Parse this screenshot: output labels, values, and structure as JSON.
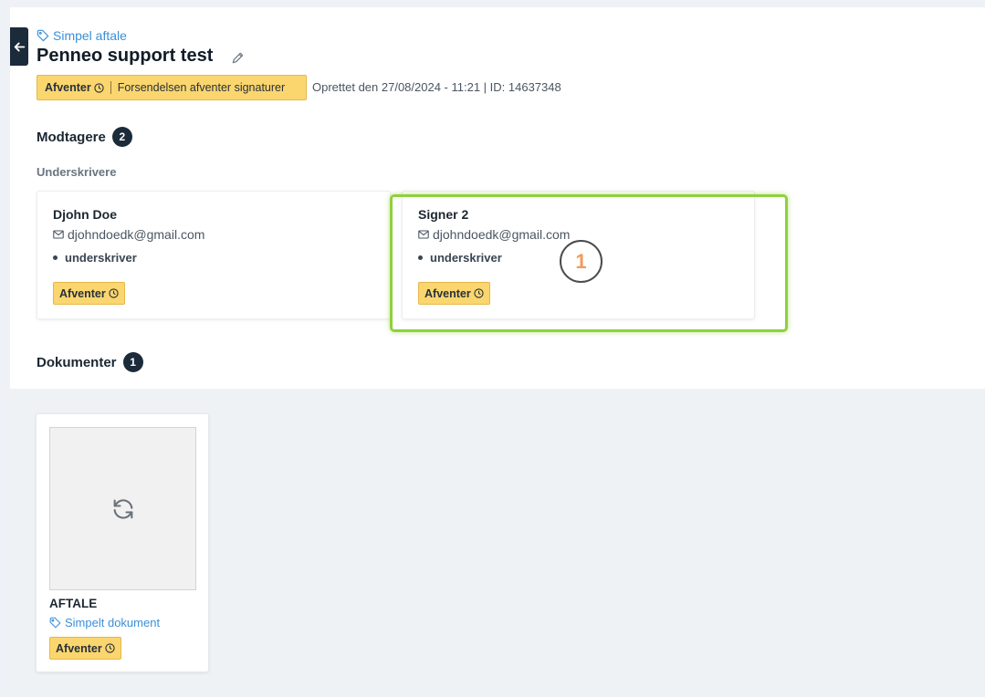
{
  "header": {
    "casefile_type": "Simpel aftale",
    "title": "Penneo support test",
    "status": {
      "label": "Afventer",
      "description": "Forsendelsen afventer signaturer"
    },
    "meta": "Oprettet den 27/08/2024 - 11:21 | ID: 14637348"
  },
  "recipients": {
    "title": "Modtagere",
    "count": "2",
    "subheading": "Underskrivere",
    "signers": [
      {
        "name": "Djohn Doe",
        "email": "djohndoedk@gmail.com",
        "role": "underskriver",
        "status": "Afventer"
      },
      {
        "name": "Signer 2",
        "email": "djohndoedk@gmail.com",
        "role": "underskriver",
        "status": "Afventer"
      }
    ]
  },
  "annotation": {
    "step": "1",
    "highlight_color": "#8fd13c"
  },
  "documents": {
    "title": "Dokumenter",
    "count": "1",
    "items": [
      {
        "title": "AFTALE",
        "type": "Simpelt dokument",
        "status": "Afventer"
      }
    ]
  },
  "colors": {
    "accent": "#3b8fd8",
    "dark": "#1c2b3a",
    "pending": "#fbd66e"
  },
  "icons": {
    "back": "arrow-left-icon",
    "tag": "tag-icon",
    "edit": "pencil-icon",
    "clock": "clock-icon",
    "email": "envelope-icon",
    "loading": "refresh-icon"
  }
}
